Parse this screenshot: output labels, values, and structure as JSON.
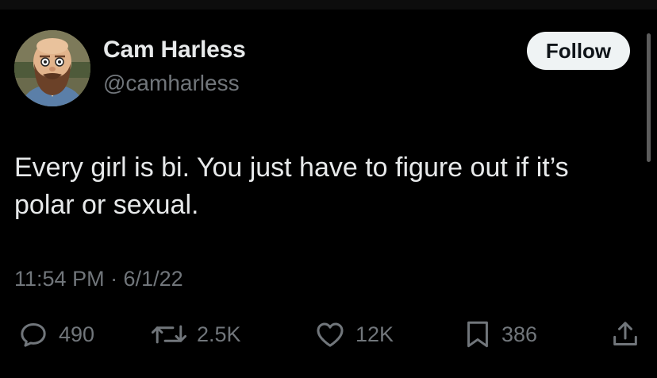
{
  "author": {
    "display_name": "Cam Harless",
    "handle": "@camharless",
    "avatar_icon": "bearded-man-avatar"
  },
  "follow_button": {
    "label": "Follow"
  },
  "tweet": {
    "text_lines": [
      "Every girl is bi. You just have to figure out if it’s",
      "polar or sexual."
    ],
    "timestamp": "11:54 PM · 6/1/22"
  },
  "actions": {
    "reply": {
      "icon": "reply-icon",
      "count": "490"
    },
    "retweet": {
      "icon": "retweet-icon",
      "count": "2.5K"
    },
    "like": {
      "icon": "heart-icon",
      "count": "12K"
    },
    "bookmark": {
      "icon": "bookmark-icon",
      "count": "386"
    },
    "share": {
      "icon": "share-icon"
    }
  },
  "colors": {
    "background": "#000000",
    "primary_text": "#e7e9ea",
    "secondary_text": "#71767b",
    "button_background": "#eff3f4",
    "button_text": "#0f1419"
  }
}
